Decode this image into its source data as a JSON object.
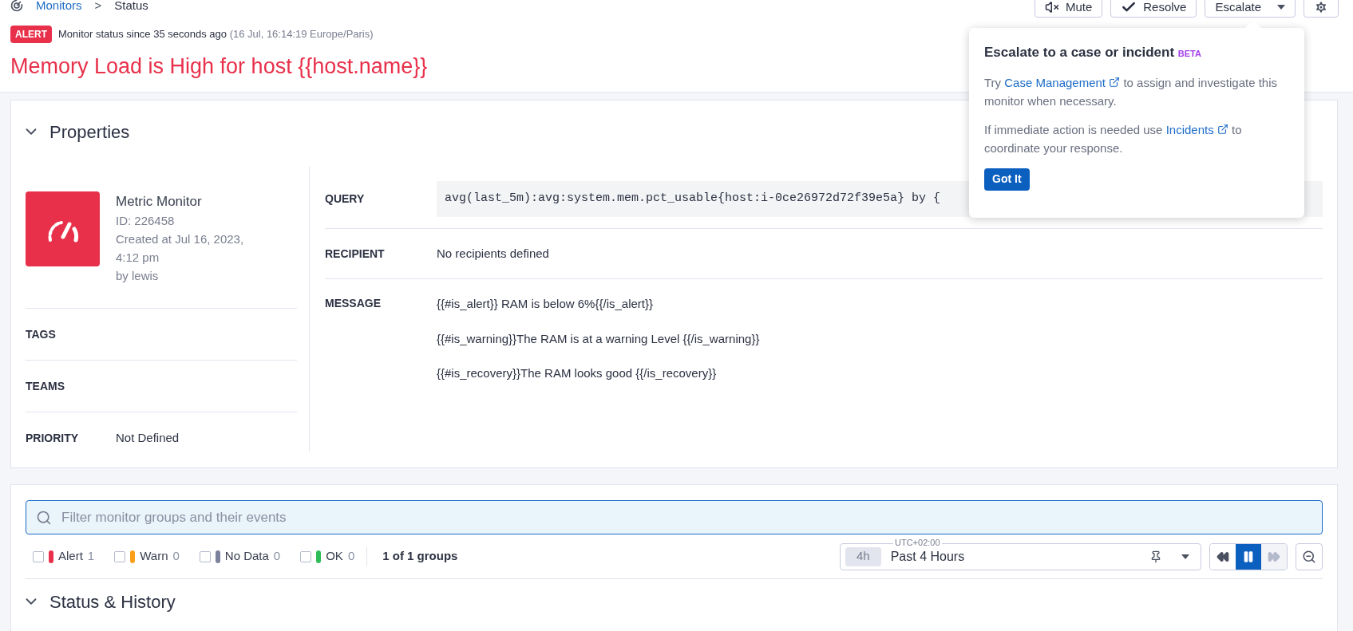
{
  "breadcrumb": {
    "parent": "Monitors",
    "separator": ">",
    "current": "Status"
  },
  "header_buttons": [
    {
      "label": "Mute",
      "kind": "mute"
    },
    {
      "label": "Resolve",
      "kind": "resolve"
    },
    {
      "label": "Escalate",
      "kind": "escalate"
    },
    {
      "kind": "settings"
    }
  ],
  "status": {
    "badge": "ALERT",
    "text": "Monitor status since 35 seconds ago",
    "timestamp": "(16 Jul, 16:14:19 Europe/Paris)"
  },
  "title": "Memory Load is High for host {{host.name}}",
  "properties": {
    "heading": "Properties",
    "expanded": true,
    "monitor": {
      "type": "Metric Monitor",
      "id": "ID: 226458",
      "created": "Created at Jul 16, 2023, 4:12 pm",
      "author": "by lewis"
    },
    "left_rows": [
      {
        "label": "TAGS"
      },
      {
        "label": "TEAMS"
      },
      {
        "label": "PRIORITY",
        "value": "Not Defined"
      }
    ],
    "query_label": "QUERY",
    "query": "avg(last_5m):avg:system.mem.pct_usable{host:i-0ce26972d72f39e5a} by {",
    "recipient_label": "RECIPIENT",
    "recipient": "No recipients defined",
    "message_label": "MESSAGE",
    "message_lines": [
      "{{#is_alert}} RAM is below 6%{{/is_alert}}",
      "{{#is_warning}}The RAM is at a warning Level {{/is_warning}}",
      "{{#is_recovery}}The RAM looks good {{/is_recovery}}"
    ]
  },
  "popover": {
    "title": "Escalate to a case or incident",
    "tag": "BETA",
    "p1_before": "Try",
    "p1_link": "Case Management",
    "p1_after": "to assign and investigate this monitor when necessary.",
    "p2_before": "If immediate action is needed use",
    "p2_link": "Incidents",
    "p2_after": "to coordinate your response.",
    "button": "Got It"
  },
  "filter": {
    "placeholder": "Filter monitor groups and their events",
    "statuses": [
      {
        "label": "Alert",
        "count": "1",
        "color": "#e8304a",
        "checked": false
      },
      {
        "label": "Warn",
        "count": "0",
        "color": "#f99f1b",
        "checked": false
      },
      {
        "label": "No Data",
        "count": "0",
        "color": "#7c819c",
        "checked": false
      },
      {
        "label": "OK",
        "count": "0",
        "color": "#2fbd5a",
        "checked": false
      }
    ],
    "groups": "1 of 1 groups"
  },
  "timeframe": {
    "timezone": "UTC+02:00",
    "short": "4h",
    "label": "Past 4 Hours"
  },
  "playback": [
    {
      "kind": "rewind",
      "selected": false,
      "disabled": false
    },
    {
      "kind": "pause",
      "selected": true,
      "disabled": false
    },
    {
      "kind": "forward",
      "selected": false,
      "disabled": true
    }
  ],
  "history": {
    "heading": "Status & History",
    "expanded": true
  }
}
